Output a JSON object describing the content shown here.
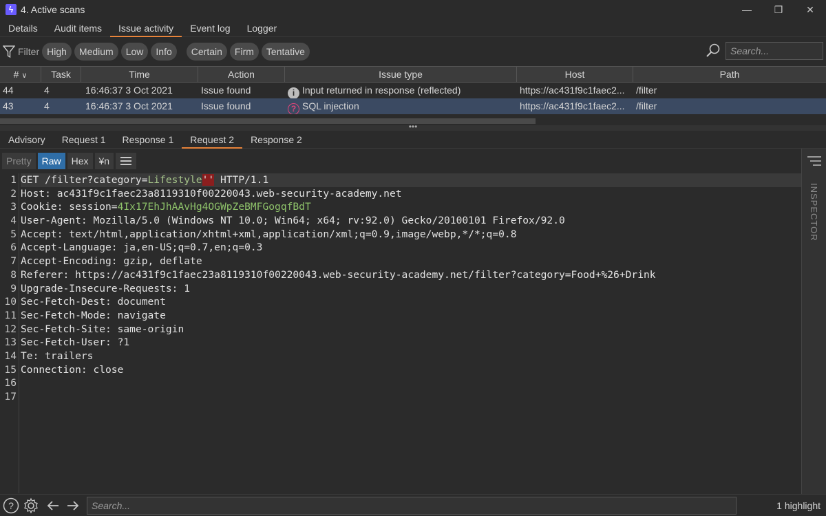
{
  "window": {
    "app_icon_glyph": "ϟ",
    "title": "4. Active scans",
    "controls": [
      "—",
      "❐",
      "✕"
    ]
  },
  "top_tabs": [
    "Details",
    "Audit items",
    "Issue activity",
    "Event log",
    "Logger"
  ],
  "active_top_tab": "Issue activity",
  "filter": {
    "label": "Filter",
    "severity": [
      "High",
      "Medium",
      "Low",
      "Info"
    ],
    "confidence": [
      "Certain",
      "Firm",
      "Tentative"
    ],
    "search_placeholder": "Search..."
  },
  "table": {
    "columns": [
      "#",
      "Task",
      "Time",
      "Action",
      "Issue type",
      "Host",
      "Path"
    ],
    "sort_indicator": "∨",
    "rows": [
      {
        "num": "44",
        "task": "4",
        "time": "16:46:37 3 Oct 2021",
        "action": "Issue found",
        "issue_icon": "info-icon",
        "issue_type": "Input returned in response (reflected)",
        "host": "https://ac431f9c1faec2...",
        "path": "/filter"
      },
      {
        "num": "43",
        "task": "4",
        "time": "16:46:37 3 Oct 2021",
        "action": "Issue found",
        "issue_icon": "question-icon",
        "issue_type": "SQL injection",
        "host": "https://ac431f9c1faec2...",
        "path": "/filter"
      }
    ],
    "selected_row": 1
  },
  "splitter_glyph": "•••",
  "sub_tabs": [
    "Advisory",
    "Request 1",
    "Response 1",
    "Request 2",
    "Response 2"
  ],
  "active_sub_tab": "Request 2",
  "format_buttons": [
    "Pretty",
    "Raw",
    "Hex",
    "¥n"
  ],
  "active_format": "Raw",
  "request": {
    "line1": {
      "method_path": "GET /filter?category=",
      "param_value": "Lifestyle",
      "injected": "''",
      "protocol": " HTTP/1.1"
    },
    "lines": [
      {
        "name": "Host:",
        "value": " ac431f9c1faec23a8119310f00220043.web-security-academy.net"
      },
      {
        "name": "Cookie:",
        "value": " session=",
        "value2": "4Ix17EhJhAAvHg4OGWpZeBMFGogqfBdT"
      },
      {
        "name": "User-Agent:",
        "value": " Mozilla/5.0 (Windows NT 10.0; Win64; x64; rv:92.0) Gecko/20100101 Firefox/92.0"
      },
      {
        "name": "Accept:",
        "value": " text/html,application/xhtml+xml,application/xml;q=0.9,image/webp,*/*;q=0.8"
      },
      {
        "name": "Accept-Language:",
        "value": " ja,en-US;q=0.7,en;q=0.3"
      },
      {
        "name": "Accept-Encoding:",
        "value": " gzip, deflate"
      },
      {
        "name": "Referer:",
        "value": " https://ac431f9c1faec23a8119310f00220043.web-security-academy.net/filter?category=Food+%26+Drink"
      },
      {
        "name": "Upgrade-Insecure-Requests:",
        "value": " 1"
      },
      {
        "name": "Sec-Fetch-Dest:",
        "value": " document"
      },
      {
        "name": "Sec-Fetch-Mode:",
        "value": " navigate"
      },
      {
        "name": "Sec-Fetch-Site:",
        "value": " same-origin"
      },
      {
        "name": "Sec-Fetch-User:",
        "value": " ?1"
      },
      {
        "name": "Te:",
        "value": " trailers"
      },
      {
        "name": "Connection:",
        "value": " close"
      },
      {
        "name": "",
        "value": ""
      },
      {
        "name": "",
        "value": ""
      }
    ],
    "line_numbers": [
      "1",
      "2",
      "3",
      "4",
      "5",
      "6",
      "7",
      "8",
      "9",
      "10",
      "11",
      "12",
      "13",
      "14",
      "15",
      "16",
      "17"
    ]
  },
  "inspector": {
    "label": "INSPECTOR"
  },
  "bottom": {
    "search_placeholder": "Search...",
    "highlight_count": "1 highlight"
  },
  "colors": {
    "accent": "#e8833a",
    "selected_row": "#3b4a62",
    "raw_active": "#2f6ea7",
    "injection_highlight": "#8b1e1e",
    "sqli_icon": "#e0457a"
  }
}
